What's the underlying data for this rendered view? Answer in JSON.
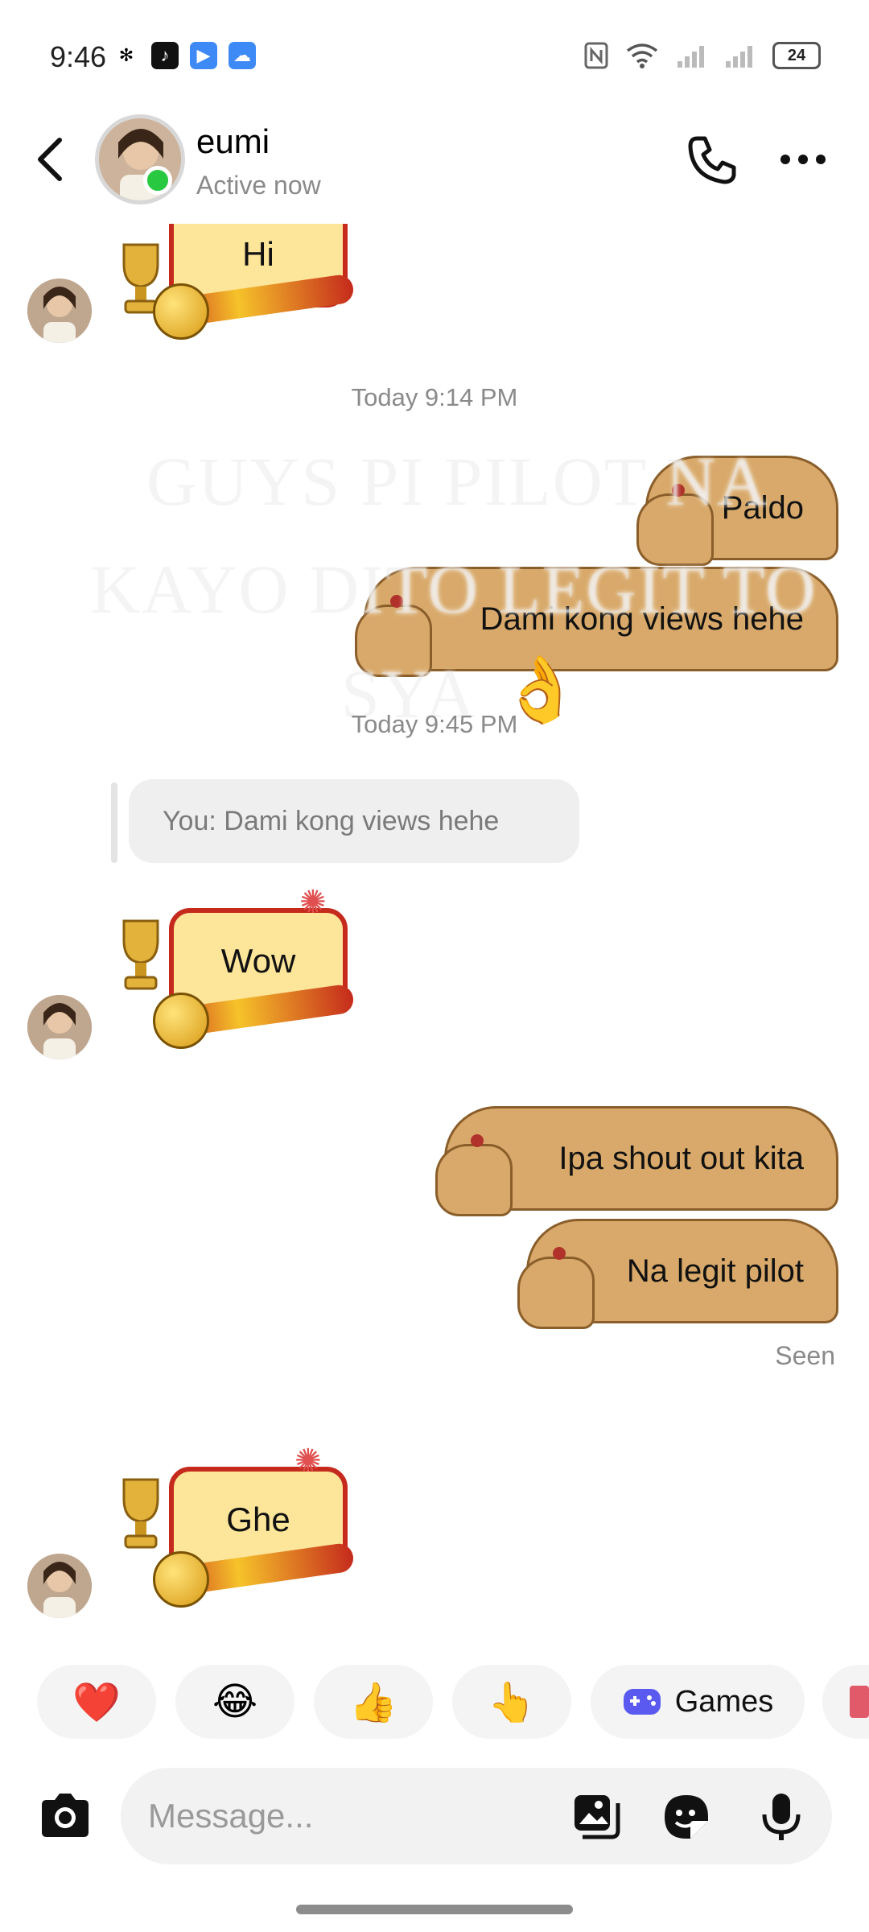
{
  "status_bar": {
    "time": "9:46",
    "battery": "24"
  },
  "header": {
    "name": "eumi",
    "status": "Active now"
  },
  "messages": {
    "hi": "Hi",
    "timestamp_1": "Today 9:14 PM",
    "paldo": "Paldo",
    "dami": "Dami kong views hehe",
    "timestamp_2": "Today 9:45 PM",
    "reply_preview": "You: Dami kong views hehe",
    "wow": "Wow",
    "shout": "Ipa shout out kita",
    "legit": "Na legit pilot",
    "seen": "Seen",
    "ghe": "Ghe"
  },
  "overlay": {
    "line1": "GUYS PI PILOT NA",
    "line2": "KAYO DITO LEGIT TO",
    "line3": "SYA",
    "emoji": "👌"
  },
  "quick_reactions": {
    "heart": "❤️",
    "laugh": "😂",
    "thumbs": "👍",
    "point": "👆",
    "games_label": "Games"
  },
  "composer": {
    "placeholder": "Message..."
  },
  "colors": {
    "online": "#28c840",
    "games_icon": "#5a5af0"
  }
}
